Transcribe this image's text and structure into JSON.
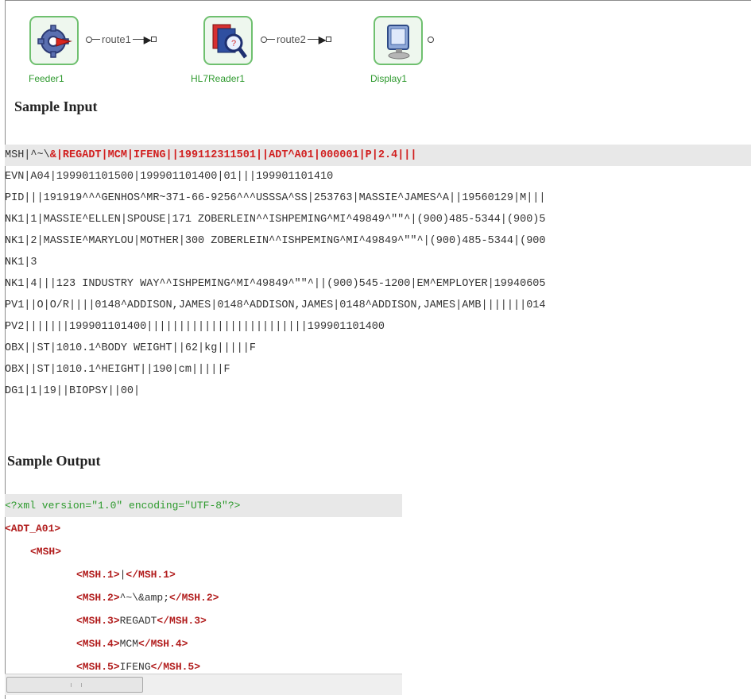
{
  "flow": {
    "nodes": [
      {
        "label": "Feeder1",
        "icon": "gear-arrow-icon"
      },
      {
        "label": "HL7Reader1",
        "icon": "document-magnifier-icon"
      },
      {
        "label": "Display1",
        "icon": "monitor-icon"
      }
    ],
    "routes": [
      "route1",
      "route2"
    ]
  },
  "headings": {
    "sample_input": "Sample Input",
    "sample_output": "Sample Output"
  },
  "hl7_lines": [
    {
      "prefix": "MSH|^~\\",
      "highlight": "&|REGADT|MCM|IFENG||199112311501||ADT^A01|000001|P|2.4|||"
    },
    {
      "text": "EVN|A04|199901101500|199901101400|01|||199901101410"
    },
    {
      "text": "PID|||191919^^^GENHOS^MR~371-66-9256^^^USSSA^SS|253763|MASSIE^JAMES^A||19560129|M|||"
    },
    {
      "text": "NK1|1|MASSIE^ELLEN|SPOUSE|171 ZOBERLEIN^^ISHPEMING^MI^49849^\"\"^|(900)485-5344|(900)5"
    },
    {
      "text": "NK1|2|MASSIE^MARYLOU|MOTHER|300 ZOBERLEIN^^ISHPEMING^MI^49849^\"\"^|(900)485-5344|(900"
    },
    {
      "text": "NK1|3"
    },
    {
      "text": "NK1|4|||123 INDUSTRY WAY^^ISHPEMING^MI^49849^\"\"^||(900)545-1200|EM^EMPLOYER|19940605"
    },
    {
      "text": "PV1||O|O/R||||0148^ADDISON,JAMES|0148^ADDISON,JAMES|0148^ADDISON,JAMES|AMB|||||||014"
    },
    {
      "text": "PV2|||||||199901101400|||||||||||||||||||||||||199901101400"
    },
    {
      "text": "OBX||ST|1010.1^BODY WEIGHT||62|kg|||||F"
    },
    {
      "text": "OBX||ST|1010.1^HEIGHT||190|cm|||||F"
    },
    {
      "text": "DG1|1|19||BIOPSY||00|"
    }
  ],
  "xml": {
    "declaration": "<?xml version=\"1.0\" encoding=\"UTF-8\"?>",
    "root_open": "<ADT_A01>",
    "msh_open": "<MSH>",
    "fields": [
      {
        "open": "<MSH.1>",
        "value": "|",
        "close": "</MSH.1>"
      },
      {
        "open": "<MSH.2>",
        "value": "^~\\&amp;",
        "close": "</MSH.2>"
      },
      {
        "open": "<MSH.3>",
        "value": "REGADT",
        "close": "</MSH.3>"
      },
      {
        "open": "<MSH.4>",
        "value": "MCM",
        "close": "</MSH.4>"
      },
      {
        "open": "<MSH.5>",
        "value": "IFENG",
        "close": "</MSH.5>"
      }
    ]
  },
  "colors": {
    "node_border": "#6fc06f",
    "node_label": "#2f9a2f",
    "hl7_highlight": "#d11f1f",
    "xml_tag": "#b21e1e",
    "xml_decl": "#2d9a2d"
  }
}
